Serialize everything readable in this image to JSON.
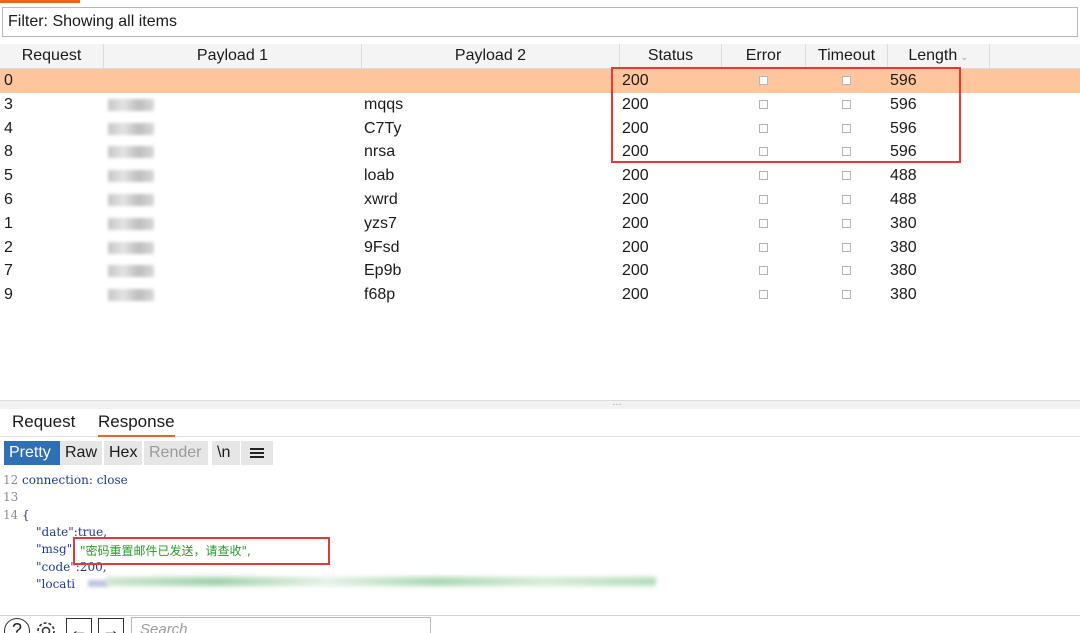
{
  "filter": {
    "text": "Filter: Showing all items"
  },
  "table": {
    "headers": {
      "request": "Request",
      "payload1": "Payload 1",
      "payload2": "Payload 2",
      "status": "Status",
      "error": "Error",
      "timeout": "Timeout",
      "length": "Length"
    },
    "rows": [
      {
        "request": "0",
        "payload2": "",
        "status": "200",
        "length": "596",
        "selected": true
      },
      {
        "request": "3",
        "payload2": "mqqs",
        "status": "200",
        "length": "596"
      },
      {
        "request": "4",
        "payload2": "C7Ty",
        "status": "200",
        "length": "596"
      },
      {
        "request": "8",
        "payload2": "nrsa",
        "status": "200",
        "length": "596"
      },
      {
        "request": "5",
        "payload2": "loab",
        "status": "200",
        "length": "488"
      },
      {
        "request": "6",
        "payload2": "xwrd",
        "status": "200",
        "length": "488"
      },
      {
        "request": "1",
        "payload2": "yzs7",
        "status": "200",
        "length": "380"
      },
      {
        "request": "2",
        "payload2": "9Fsd",
        "status": "200",
        "length": "380"
      },
      {
        "request": "7",
        "payload2": "Ep9b",
        "status": "200",
        "length": "380"
      },
      {
        "request": "9",
        "payload2": "f68p",
        "status": "200",
        "length": "380"
      }
    ]
  },
  "detail_tabs": {
    "request": "Request",
    "response": "Response"
  },
  "view_tabs": {
    "pretty": "Pretty",
    "raw": "Raw",
    "hex": "Hex",
    "render": "Render",
    "newline": "\\n"
  },
  "editor": {
    "line_numbers": [
      "12",
      "13",
      "14"
    ],
    "line12": "connection: close",
    "line14": "{",
    "date_line": "\"date\":true,",
    "msg_key": "\"msg\":",
    "msg_value": "\"密码重置邮件已发送，请查收\",",
    "code_line": "\"code\":200,",
    "location_key": "\"locati"
  },
  "bottom": {
    "search_placeholder": "Search",
    "help_icon": "?",
    "settings_icon": "gear",
    "back_icon": "←",
    "forward_icon": "→"
  },
  "colors": {
    "accent": "#e8651f",
    "selected_row": "#ffc59c",
    "highlight_box": "#e23a3a",
    "active_view_tab": "#2f6fb3"
  }
}
